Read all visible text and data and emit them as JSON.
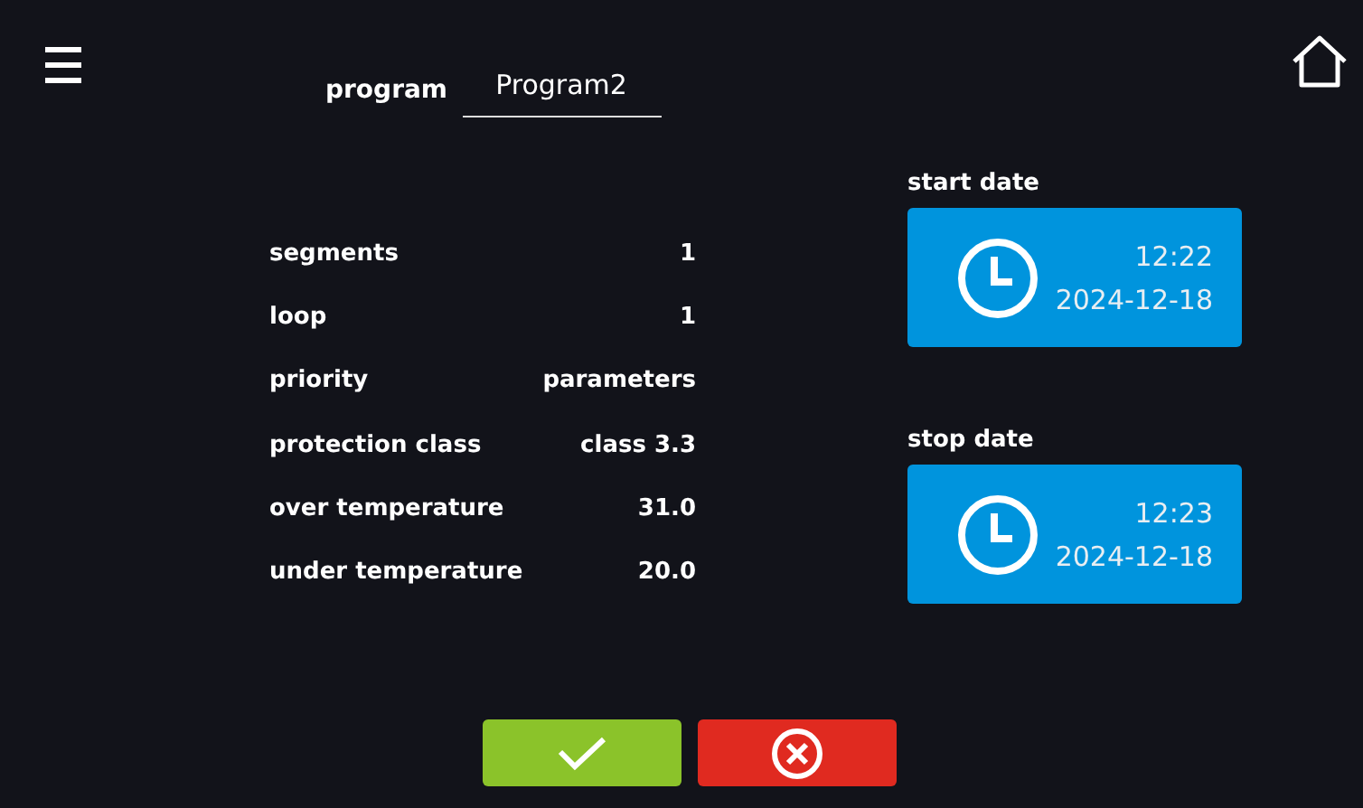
{
  "program": {
    "label": "program",
    "value": "Program2"
  },
  "parameters": [
    {
      "name": "segments",
      "value": "1"
    },
    {
      "name": "loop",
      "value": "1"
    },
    {
      "name": "priority",
      "value": "parameters"
    },
    {
      "name": "protection class",
      "value": "class 3.3"
    },
    {
      "name": "over temperature",
      "value": "31.0"
    },
    {
      "name": "under temperature",
      "value": "20.0"
    }
  ],
  "dates": [
    {
      "label": "start date",
      "time": "12:22",
      "date": "2024-12-18"
    },
    {
      "label": "stop date",
      "time": "12:23",
      "date": "2024-12-18"
    }
  ],
  "buttons": [
    {
      "kind": "confirm"
    },
    {
      "kind": "cancel"
    }
  ]
}
